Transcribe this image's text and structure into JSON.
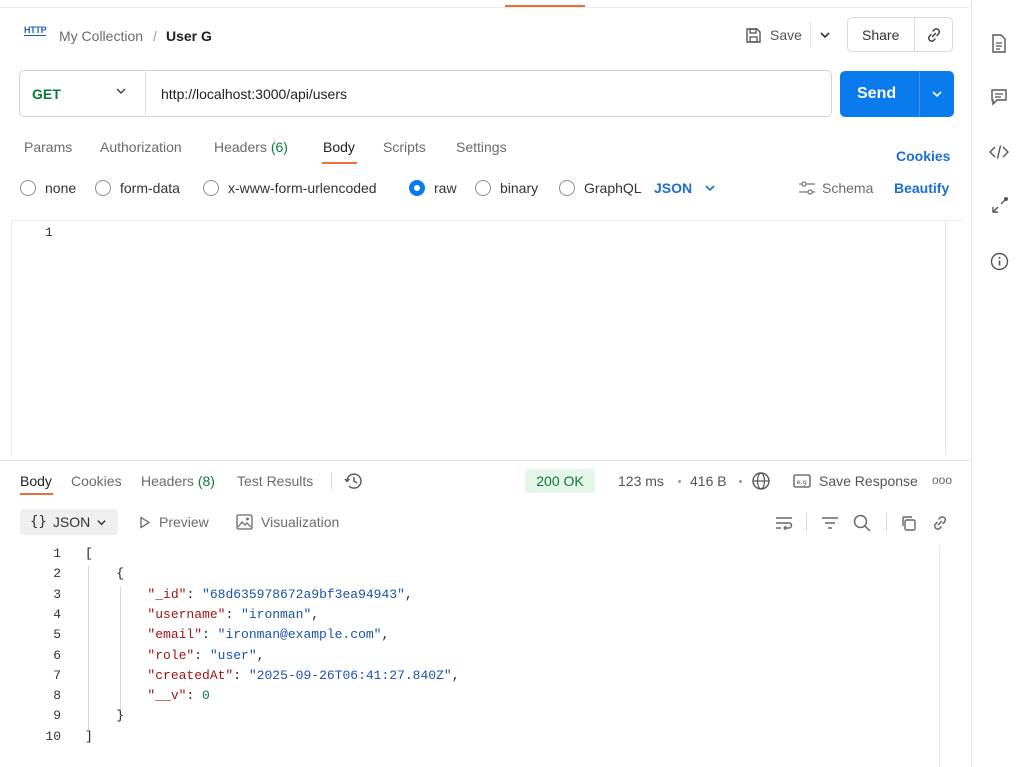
{
  "header": {
    "protocol_badge": "HTTP",
    "collection": "My Collection",
    "separator": "/",
    "request_name": "User G",
    "save_label": "Save",
    "share_label": "Share"
  },
  "request": {
    "method": "GET",
    "url": "http://localhost:3000/api/users",
    "send_label": "Send",
    "tabs": [
      {
        "label": "Params"
      },
      {
        "label": "Authorization"
      },
      {
        "label": "Headers",
        "count": "(6)"
      },
      {
        "label": "Body"
      },
      {
        "label": "Scripts"
      },
      {
        "label": "Settings"
      }
    ],
    "active_tab": "Body",
    "cookies_label": "Cookies",
    "body_types": [
      "none",
      "form-data",
      "x-www-form-urlencoded",
      "raw",
      "binary",
      "GraphQL"
    ],
    "selected_body_type": "raw",
    "format": "JSON",
    "schema_label": "Schema",
    "beautify_label": "Beautify",
    "editor_lines": [
      "1"
    ]
  },
  "response": {
    "tabs": [
      {
        "label": "Body"
      },
      {
        "label": "Cookies"
      },
      {
        "label": "Headers",
        "count": "(8)"
      },
      {
        "label": "Test Results"
      }
    ],
    "active_tab": "Body",
    "status": "200 OK",
    "time": "123 ms",
    "size": "416 B",
    "save_response_label": "Save Response",
    "more_label": "ooo",
    "view_format": "JSON",
    "preview_label": "Preview",
    "visualization_label": "Visualization",
    "lines": [
      {
        "num": "1",
        "parts": [
          [
            "p",
            "["
          ]
        ]
      },
      {
        "num": "2",
        "parts": [
          [
            "p",
            "    {"
          ]
        ]
      },
      {
        "num": "3",
        "parts": [
          [
            "p",
            "        "
          ],
          [
            "k",
            "\"_id\""
          ],
          [
            "p",
            ": "
          ],
          [
            "s",
            "\"68d635978672a9bf3ea94943\""
          ],
          [
            "p",
            ","
          ]
        ]
      },
      {
        "num": "4",
        "parts": [
          [
            "p",
            "        "
          ],
          [
            "k",
            "\"username\""
          ],
          [
            "p",
            ": "
          ],
          [
            "s",
            "\"ironman\""
          ],
          [
            "p",
            ","
          ]
        ]
      },
      {
        "num": "5",
        "parts": [
          [
            "p",
            "        "
          ],
          [
            "k",
            "\"email\""
          ],
          [
            "p",
            ": "
          ],
          [
            "s",
            "\"ironman@example.com\""
          ],
          [
            "p",
            ","
          ]
        ]
      },
      {
        "num": "6",
        "parts": [
          [
            "p",
            "        "
          ],
          [
            "k",
            "\"role\""
          ],
          [
            "p",
            ": "
          ],
          [
            "s",
            "\"user\""
          ],
          [
            "p",
            ","
          ]
        ]
      },
      {
        "num": "7",
        "parts": [
          [
            "p",
            "        "
          ],
          [
            "k",
            "\"createdAt\""
          ],
          [
            "p",
            ": "
          ],
          [
            "s",
            "\"2025-09-26T06:41:27.840Z\""
          ],
          [
            "p",
            ","
          ]
        ]
      },
      {
        "num": "8",
        "parts": [
          [
            "p",
            "        "
          ],
          [
            "k",
            "\"__v\""
          ],
          [
            "p",
            ": "
          ],
          [
            "n",
            "0"
          ]
        ]
      },
      {
        "num": "9",
        "parts": [
          [
            "p",
            "    }"
          ]
        ]
      },
      {
        "num": "10",
        "parts": [
          [
            "p",
            "]"
          ]
        ]
      }
    ]
  },
  "colors": {
    "accent": "#f26b3a",
    "primary": "#097bed",
    "link": "#1a6fd1",
    "method_get": "#0a7a3a",
    "status_bg": "#e3f6e8"
  },
  "sidebar_icons": [
    "document-icon",
    "comment-icon",
    "code-icon",
    "compress-icon",
    "info-icon"
  ]
}
